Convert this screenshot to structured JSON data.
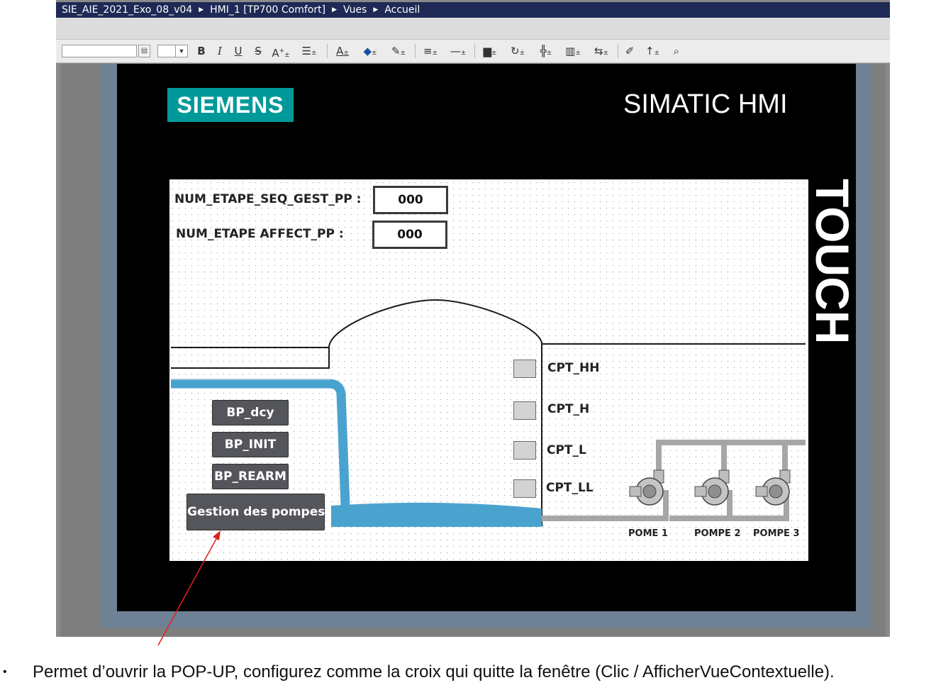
{
  "app": {
    "breadcrumb": [
      "SIE_AIE_2021_Exo_08_v04",
      "HMI_1 [TP700 Comfort]",
      "Vues",
      "Accueil"
    ]
  },
  "toolbar": {
    "bold": "B",
    "italic": "I",
    "underline": "U",
    "strike": "S",
    "font_size": "A"
  },
  "device": {
    "brand": "SIEMENS",
    "product": "SIMATIC HMI",
    "panel_label": "TOUCH"
  },
  "screen": {
    "fields": [
      {
        "label": "NUM_ETAPE_SEQ_GEST_PP :",
        "value": "000"
      },
      {
        "label": "NUM_ETAPE AFFECT_PP :",
        "value": "000"
      }
    ],
    "buttons": {
      "bp_dcy": "BP_dcy",
      "bp_init": "BP_INIT",
      "bp_rearm": "BP_REARM",
      "gestion": "Gestion des pompes"
    },
    "sensors": [
      "CPT_HH",
      "CPT_H",
      "CPT_L",
      "CPT_LL"
    ],
    "pumps": [
      "POME 1",
      "POMPE 2",
      "POMPE 3"
    ],
    "colors": {
      "water": "#4aa3cf",
      "pipe": "#a6a6a6",
      "siemens": "#009999"
    }
  },
  "caption": {
    "bullet": "•",
    "text": "Permet d’ouvrir la POP-UP, configurez comme la croix qui quitte la fenêtre (Clic / AfficherVueContextuelle)."
  },
  "annotation": {
    "arrow_color": "#e0201c"
  }
}
